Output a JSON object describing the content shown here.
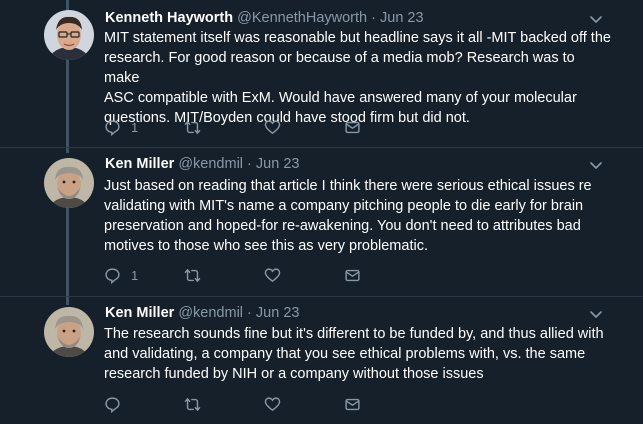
{
  "tweets": [
    {
      "name": "Kenneth Hayworth",
      "handle": "@KennethHayworth",
      "separator": "·",
      "date": "Jun 23",
      "lines": [
        "MIT statement itself was reasonable but headline says it all -MIT backed off the",
        "research. For good reason or because of a media mob? Research was to make",
        "ASC compatible with ExM. Would have answered many of your molecular",
        "questions. MIT/Boyden could have stood firm but did not."
      ],
      "reply_count": "1",
      "retweet_count": "",
      "like_count": "",
      "icons": [
        "reply-icon",
        "retweet-icon",
        "like-icon",
        "dm-icon"
      ]
    },
    {
      "name": "Ken Miller",
      "handle": "@kendmil",
      "separator": "·",
      "date": "Jun 23",
      "lines": [
        "Just based on reading that article I think there were serious ethical issues re",
        "validating with MIT's name a company pitching people to die early for brain",
        "preservation and hoped-for re-awakening. You don't need to attributes bad",
        "motives to those who see this as very problematic."
      ],
      "reply_count": "1",
      "retweet_count": "",
      "like_count": "",
      "icons": [
        "reply-icon",
        "retweet-icon",
        "like-icon",
        "dm-icon"
      ]
    },
    {
      "name": "Ken Miller",
      "handle": "@kendmil",
      "separator": "·",
      "date": "Jun 23",
      "lines": [
        "The research sounds fine but it's different to be funded by, and thus allied with",
        "and validating, a company that you see ethical problems with, vs. the same",
        "research funded by NIH or a company without those issues"
      ],
      "reply_count": "",
      "retweet_count": "",
      "like_count": "",
      "icons": [
        "reply-icon",
        "retweet-icon",
        "like-icon",
        "dm-icon"
      ]
    }
  ],
  "colors": {
    "background": "#15202b",
    "text": "#ffffff",
    "muted": "#8899a6",
    "thread_line": "#3d5466",
    "divider": "#2a3744"
  }
}
